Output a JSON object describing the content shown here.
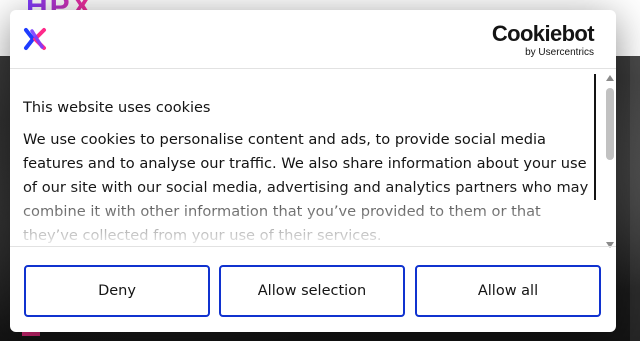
{
  "dialog": {
    "brand": {
      "name": "Cookiebot",
      "byline": "by Usercentrics"
    },
    "title": "This website uses cookies",
    "body": "We use cookies to personalise content and ads, to provide social media features and to analyse our traffic. We also share information about your use of our site with our social media, advertising and analytics partners who may combine it with other information that you’ve provided to them or that they’ve collected from your use of their services.",
    "buttons": {
      "deny": "Deny",
      "allow_selection": "Allow selection",
      "allow_all": "Allow all"
    }
  },
  "background": {
    "logo_text": "HPX"
  },
  "colors": {
    "button_border": "#1032cf",
    "logo_blue": "#1e3cff",
    "logo_pink": "#ff2a8a"
  },
  "icons": [
    "site-x-logo-icon",
    "scroll-up-icon",
    "scroll-down-icon"
  ]
}
